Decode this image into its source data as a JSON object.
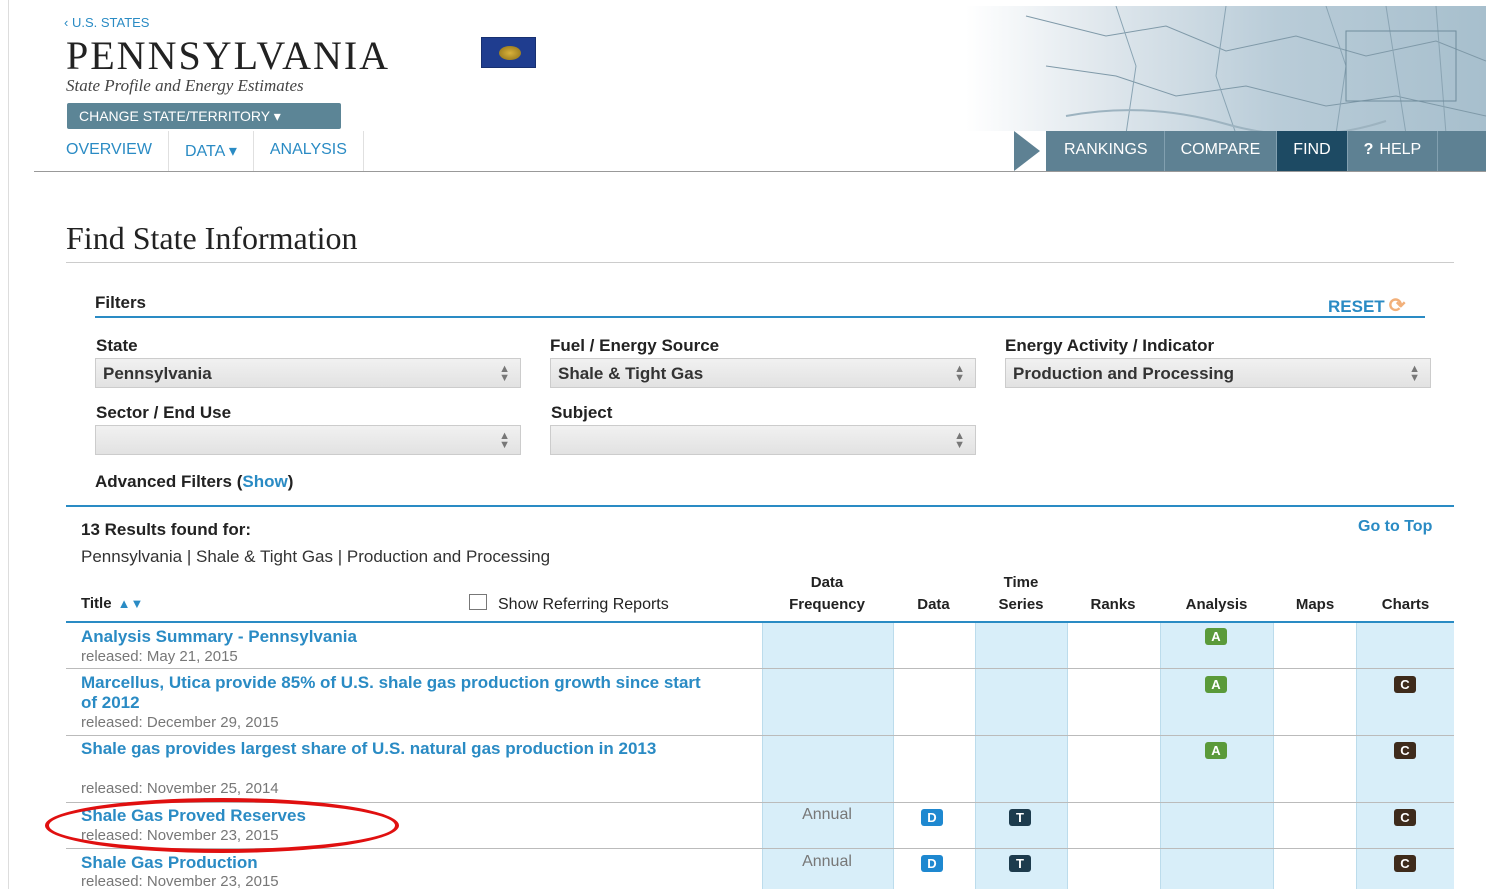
{
  "header": {
    "breadcrumb": "‹ U.S. STATES",
    "state_name": "PENNSYLVANIA",
    "subtitle": "State Profile and Energy Estimates",
    "change_state_label": "CHANGE STATE/TERRITORY ▾"
  },
  "nav": {
    "left": [
      "OVERVIEW",
      "DATA ▾",
      "ANALYSIS"
    ],
    "right": [
      "RANKINGS",
      "COMPARE",
      "FIND",
      "HELP"
    ],
    "active": "FIND",
    "help_glyph": "?"
  },
  "page_title": "Find State Information",
  "filters": {
    "heading": "Filters",
    "reset_label": "RESET",
    "state_label": "State",
    "state_value": "Pennsylvania",
    "fuel_label": "Fuel / Energy Source",
    "fuel_value": "Shale & Tight Gas",
    "activity_label": "Energy Activity / Indicator",
    "activity_value": "Production and Processing",
    "sector_label": "Sector / End Use",
    "sector_value": "",
    "subject_label": "Subject",
    "subject_value": "",
    "advanced_prefix": "Advanced Filters (",
    "advanced_link": "Show",
    "advanced_suffix": ")"
  },
  "results": {
    "count_label": "13 Results found for:",
    "go_to_top": "Go to Top",
    "query": "Pennsylvania | Shale & Tight Gas | Production and Processing",
    "show_referring": "Show Referring Reports",
    "headers": {
      "title": "Title",
      "data_frequency_1": "Data",
      "data_frequency_2": "Frequency",
      "data": "Data",
      "time_series_1": "Time",
      "time_series_2": "Series",
      "ranks": "Ranks",
      "analysis": "Analysis",
      "maps": "Maps",
      "charts": "Charts"
    },
    "rows": [
      {
        "title": "Analysis Summary - Pennsylvania",
        "released": "released: May 21, 2015",
        "frequency": "",
        "badges": [
          "A"
        ]
      },
      {
        "title": "Marcellus, Utica provide 85% of U.S. shale gas production growth since start of 2012",
        "released": "released: December 29, 2015",
        "frequency": "",
        "badges": [
          "A",
          "C"
        ]
      },
      {
        "title": "Shale gas provides largest share of U.S. natural gas production in 2013",
        "released": "released: November 25, 2014",
        "frequency": "",
        "badges": [
          "A",
          "C"
        ]
      },
      {
        "title": "Shale Gas Proved Reserves",
        "released": "released: November 23, 2015",
        "frequency": "Annual",
        "badges": [
          "D",
          "T",
          "C"
        ]
      },
      {
        "title": "Shale Gas Production",
        "released": "released: November 23, 2015",
        "frequency": "Annual",
        "badges": [
          "D",
          "T",
          "C"
        ]
      }
    ]
  },
  "badge_colors": {
    "A": "#5a9a3a",
    "C": "#3e2b1c",
    "D": "#1e88d0",
    "T": "#1d3b4d"
  },
  "icons": {
    "sort": "sort-updown-icon",
    "reset": "refresh-icon",
    "select_caret": "updown-caret-icon"
  }
}
